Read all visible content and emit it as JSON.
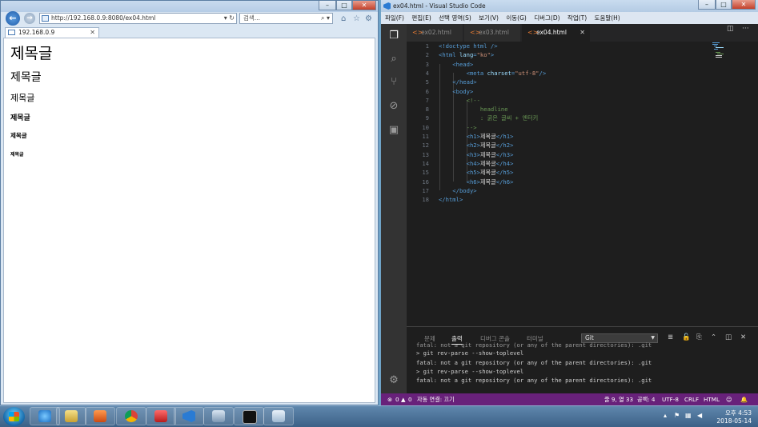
{
  "browser": {
    "address": "http://192.168.0.9:8080/ex04.html",
    "search_placeholder": "검색...",
    "tab_title": "192.168.0.9",
    "headings": [
      "제목글",
      "제목글",
      "제목글",
      "제목글",
      "제목글",
      "제목글"
    ]
  },
  "vscode": {
    "title": "ex04.html - Visual Studio Code",
    "menu": [
      "파일(F)",
      "편집(E)",
      "선택 영역(S)",
      "보기(V)",
      "이동(G)",
      "디버그(D)",
      "작업(T)",
      "도움말(H)"
    ],
    "tabs": [
      "ex02.html",
      "ex03.html",
      "ex04.html"
    ],
    "active_tab": "ex04.html",
    "code_lines": [
      "<!doctype html />",
      "<html lang=\"ko\">",
      "    <head>",
      "        <meta charset=\"utf-8\"/>",
      "    </head>",
      "    <body>",
      "        <!--",
      "            headline",
      "            : 굵은 글씨 + 엔터키",
      "        -->",
      "        <h1>제목글</h1>",
      "        <h2>제목글</h2>",
      "        <h3>제목글</h3>",
      "        <h4>제목글</h4>",
      "        <h5>제목글</h5>",
      "        <h6>제목글</h6>",
      "    </body>",
      "</html>"
    ],
    "panel": {
      "tabs": [
        "문제",
        "출력",
        "디버그 콘솔",
        "터미널"
      ],
      "active_tab": "출력",
      "output_channel": "Git",
      "output_lines": [
        "fatal: not a git repository (or any of the parent directories): .git",
        "> git rev-parse --show-toplevel",
        "fatal: not a git repository (or any of the parent directories): .git",
        "> git rev-parse --show-toplevel",
        "fatal: not a git repository (or any of the parent directories): .git"
      ]
    },
    "status": {
      "errors": "0",
      "warnings": "0",
      "autosave": "자동 연결: 끄기",
      "position": "줄 9, 열 33",
      "indent": "공백: 4",
      "encoding": "UTF-8",
      "eol": "CRLF",
      "language": "HTML"
    }
  },
  "taskbar": {
    "time": "오후 4:53",
    "date": "2018-05-14"
  },
  "colors": {
    "vscode_status": "#68217a",
    "editor_bg": "#1e1e1e",
    "tag": "#569cd6",
    "attr": "#9cdcfe",
    "string": "#ce9178",
    "comment": "#6a9955"
  }
}
